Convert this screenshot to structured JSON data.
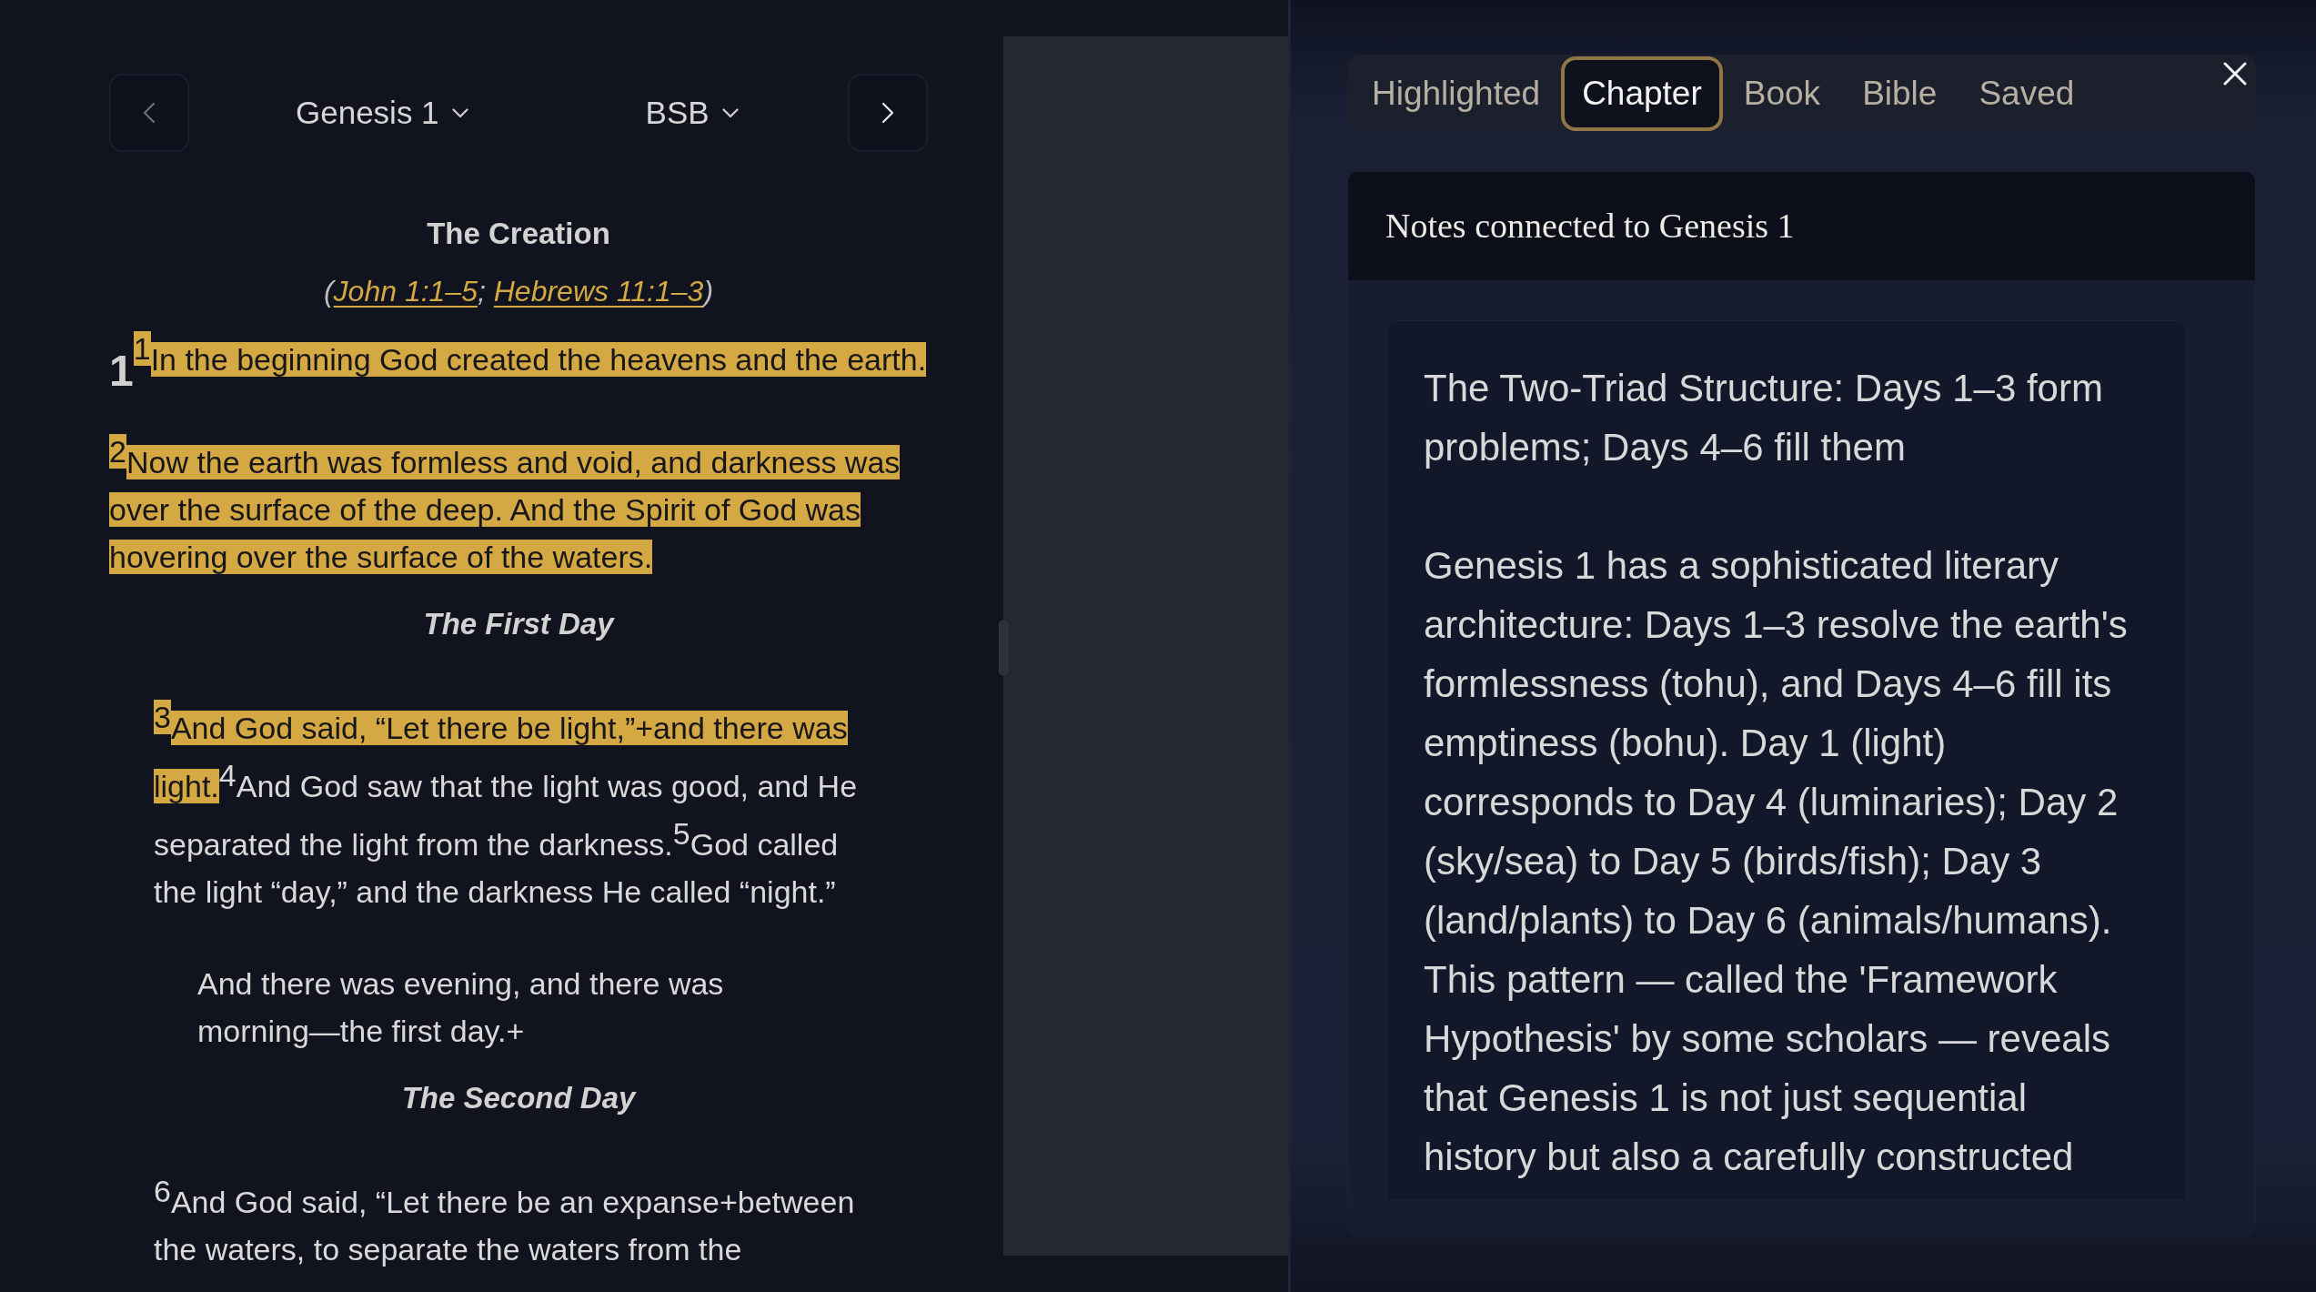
{
  "reader": {
    "chapter_selector": "Genesis 1",
    "translation_selector": "BSB",
    "blocks": [
      {
        "kind": "section_heading",
        "text": "The Creation"
      },
      {
        "kind": "cross_references",
        "open": "(",
        "refs": [
          "John 1:1–5",
          "Hebrews 11:1–3"
        ],
        "separator": ";",
        "close": ")"
      },
      {
        "kind": "chapter_start",
        "chapter_number": "1",
        "verses": [
          {
            "number": "1",
            "text": "In the beginning God created the heavens and the earth.",
            "highlighted": true
          }
        ]
      },
      {
        "kind": "prose",
        "verses": [
          {
            "number": "2",
            "text": "Now the earth was formless and void, and darkness was over the surface of the deep. And the Spirit of God was hovering over the surface of the waters.",
            "highlighted": true
          }
        ]
      },
      {
        "kind": "subheading",
        "text": "The First Day"
      },
      {
        "kind": "indented",
        "verses": [
          {
            "number": "3",
            "text": "And God said, “Let there be light,”+and there was light.",
            "highlighted": true
          },
          {
            "number": "4",
            "text": "And God saw that the light was good, and He separated the light from the darkness.",
            "highlighted": false
          },
          {
            "number": "5",
            "text": "God called the light “day,” and the darkness He called “night.”",
            "highlighted": false
          }
        ]
      },
      {
        "kind": "poetry",
        "verses": [
          {
            "text": "And there was evening, and there was morning—the first day.+",
            "highlighted": false
          }
        ]
      },
      {
        "kind": "subheading",
        "text": "The Second Day"
      },
      {
        "kind": "indented",
        "verses": [
          {
            "number": "6",
            "text": "And God said, “Let there be an expanse+between the waters, to separate the waters from the",
            "highlighted": false
          }
        ]
      }
    ]
  },
  "notes_panel": {
    "tabs": [
      {
        "label": "Highlighted",
        "selected": false
      },
      {
        "label": "Chapter",
        "selected": true
      },
      {
        "label": "Book",
        "selected": false
      },
      {
        "label": "Bible",
        "selected": false
      },
      {
        "label": "Saved",
        "selected": false
      }
    ],
    "title": "Notes connected to Genesis 1",
    "notes": [
      {
        "paragraphs": [
          "The Two-Triad Structure: Days 1–3 form problems; Days 4–6 fill them",
          "Genesis 1 has a sophisticated literary architecture: Days 1–3 resolve the earth's formlessness (tohu), and Days 4–6 fill its emptiness (bohu). Day 1 (light) corresponds to Day 4 (luminaries); Day 2 (sky/sea) to Day 5 (birds/fish); Day 3 (land/plants) to Day 6 (animals/humans). This pattern — called the 'Framework Hypothesis' by some scholars — reveals that Genesis 1 is not just sequential history but also a carefully constructed"
        ]
      }
    ]
  }
}
